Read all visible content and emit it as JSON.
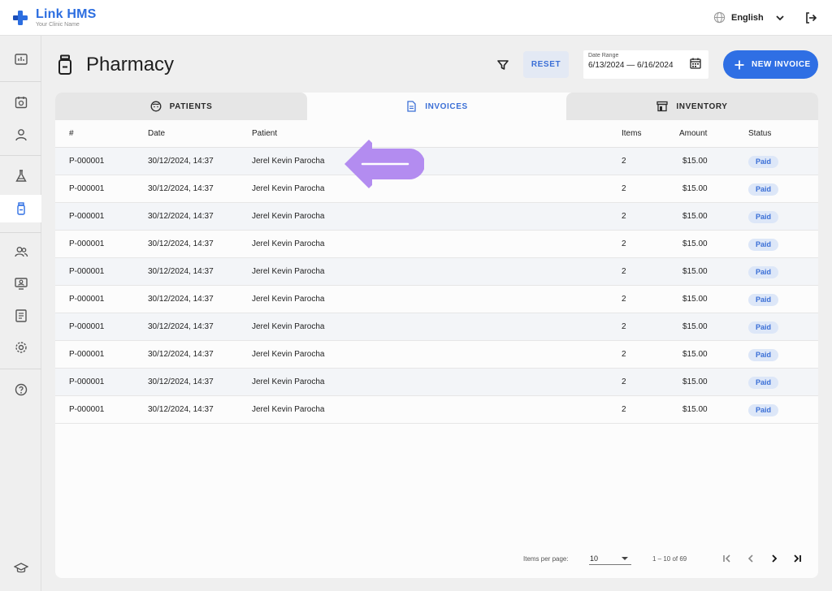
{
  "app": {
    "name": "Link HMS",
    "subtitle": "Your Clinic Name",
    "language": "English",
    "brand_color": "#2b6de0"
  },
  "sidebar": {
    "items": [
      {
        "icon": "dashboard-icon",
        "active": false
      },
      {
        "icon": "calendar-icon",
        "active": false
      },
      {
        "icon": "user-icon",
        "active": false
      },
      {
        "icon": "lab-flask-icon",
        "active": false
      },
      {
        "icon": "medicine-bottle-icon",
        "active": true
      },
      {
        "icon": "users-group-icon",
        "active": false
      },
      {
        "icon": "monitor-user-icon",
        "active": false
      },
      {
        "icon": "report-icon",
        "active": false
      },
      {
        "icon": "settings-gear-icon",
        "active": false
      },
      {
        "icon": "help-icon",
        "active": false
      },
      {
        "icon": "graduation-cap-icon",
        "active": false
      }
    ]
  },
  "page": {
    "title": "Pharmacy",
    "reset_label": "RESET",
    "date_range_label": "Date Range",
    "date_range_value": "6/13/2024 — 6/16/2024",
    "new_invoice_label": "NEW INVOICE"
  },
  "tabs": [
    {
      "label": "PATIENTS",
      "icon": "face-icon",
      "active": false
    },
    {
      "label": "INVOICES",
      "icon": "document-icon",
      "active": true
    },
    {
      "label": "INVENTORY",
      "icon": "store-icon",
      "active": false
    }
  ],
  "table": {
    "headers": {
      "id": "#",
      "date": "Date",
      "patient": "Patient",
      "items": "Items",
      "amount": "Amount",
      "status": "Status"
    },
    "rows": [
      {
        "id": "P-000001",
        "date": "30/12/2024, 14:37",
        "patient": "Jerel Kevin Parocha",
        "items": "2",
        "amount": "$15.00",
        "status": "Paid"
      },
      {
        "id": "P-000001",
        "date": "30/12/2024, 14:37",
        "patient": "Jerel Kevin Parocha",
        "items": "2",
        "amount": "$15.00",
        "status": "Paid"
      },
      {
        "id": "P-000001",
        "date": "30/12/2024, 14:37",
        "patient": "Jerel Kevin Parocha",
        "items": "2",
        "amount": "$15.00",
        "status": "Paid"
      },
      {
        "id": "P-000001",
        "date": "30/12/2024, 14:37",
        "patient": "Jerel Kevin Parocha",
        "items": "2",
        "amount": "$15.00",
        "status": "Paid"
      },
      {
        "id": "P-000001",
        "date": "30/12/2024, 14:37",
        "patient": "Jerel Kevin Parocha",
        "items": "2",
        "amount": "$15.00",
        "status": "Paid"
      },
      {
        "id": "P-000001",
        "date": "30/12/2024, 14:37",
        "patient": "Jerel Kevin Parocha",
        "items": "2",
        "amount": "$15.00",
        "status": "Paid"
      },
      {
        "id": "P-000001",
        "date": "30/12/2024, 14:37",
        "patient": "Jerel Kevin Parocha",
        "items": "2",
        "amount": "$15.00",
        "status": "Paid"
      },
      {
        "id": "P-000001",
        "date": "30/12/2024, 14:37",
        "patient": "Jerel Kevin Parocha",
        "items": "2",
        "amount": "$15.00",
        "status": "Paid"
      },
      {
        "id": "P-000001",
        "date": "30/12/2024, 14:37",
        "patient": "Jerel Kevin Parocha",
        "items": "2",
        "amount": "$15.00",
        "status": "Paid"
      },
      {
        "id": "P-000001",
        "date": "30/12/2024, 14:37",
        "patient": "Jerel Kevin Parocha",
        "items": "2",
        "amount": "$15.00",
        "status": "Paid"
      }
    ]
  },
  "pagination": {
    "items_per_page_label": "Items per page:",
    "items_per_page_value": "10",
    "range_text": "1 – 10 of 69"
  },
  "annotation": {
    "icon": "left-arrow-icon",
    "color": "#b38cf0"
  }
}
